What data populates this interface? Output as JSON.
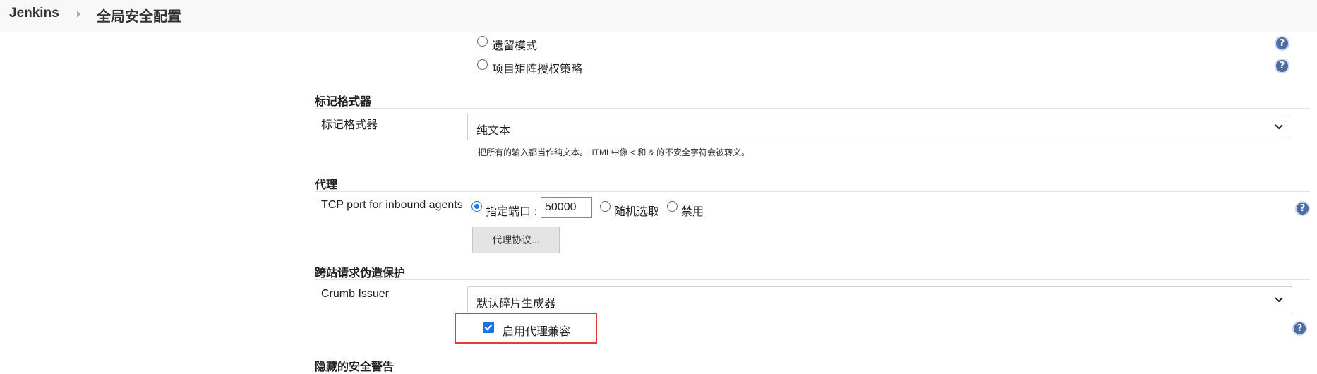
{
  "breadcrumb": {
    "root": "Jenkins",
    "current": "全局安全配置"
  },
  "authorization": {
    "options": [
      {
        "label": "遗留模式",
        "checked": false
      },
      {
        "label": "项目矩阵授权策略",
        "checked": false
      }
    ]
  },
  "markup": {
    "section_title": "标记格式器",
    "field_label": "标记格式器",
    "selected": "纯文本",
    "description": "把所有的输入都当作纯文本。HTML中像 < 和 & 的不安全字符会被转义。"
  },
  "agent": {
    "section_title": "代理",
    "field_label": "TCP port for inbound agents",
    "fixed_label": "指定端口 :",
    "port_value": "50000",
    "random_label": "随机选取",
    "disabled_label": "禁用",
    "protocols_button": "代理协议..."
  },
  "csrf": {
    "section_title": "跨站请求伪造保护",
    "field_label": "Crumb Issuer",
    "selected": "默认碎片生成器",
    "proxy_compat_label": "启用代理兼容"
  },
  "hidden": {
    "section_title": "隐藏的安全警告"
  },
  "icons": {
    "help": "help-icon",
    "chevron": "chevron-down-icon",
    "breadcrumb_sep": "caret-right-icon",
    "help_glyph": "?"
  },
  "colors": {
    "accent": "#1a73e8",
    "help": "#4e6ea3",
    "highlight": "#e53935"
  }
}
